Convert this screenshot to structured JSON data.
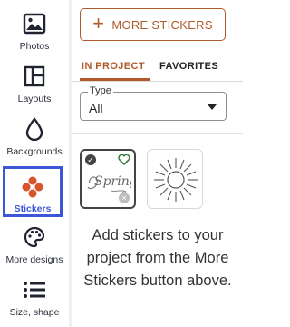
{
  "sidebar": {
    "items": [
      {
        "label": "Photos",
        "icon": "photo-icon"
      },
      {
        "label": "Layouts",
        "icon": "layout-icon"
      },
      {
        "label": "Backgrounds",
        "icon": "droplet-icon"
      },
      {
        "label": "Stickers",
        "icon": "flower-icon",
        "active": true
      },
      {
        "label": "More designs",
        "icon": "palette-icon"
      },
      {
        "label": "Size, shape",
        "icon": "list-icon"
      }
    ]
  },
  "panel": {
    "more_button": {
      "plus": "+",
      "label": "MORE STICKERS"
    },
    "tabs": [
      {
        "label": "IN PROJECT",
        "active": true
      },
      {
        "label": "FAVORITES",
        "active": false
      }
    ],
    "type_select": {
      "legend": "Type",
      "value": "All"
    },
    "stickers": [
      {
        "name": "spring-script-sticker",
        "text": "Spring",
        "checked": true,
        "favorite": true
      },
      {
        "name": "sunburst-sticker"
      }
    ],
    "empty_message": "Add stickers to your project from the More Stickers button above."
  },
  "colors": {
    "accent": "#b05a2b",
    "active_border": "#3d56d8",
    "favorite": "#3a7d44"
  }
}
